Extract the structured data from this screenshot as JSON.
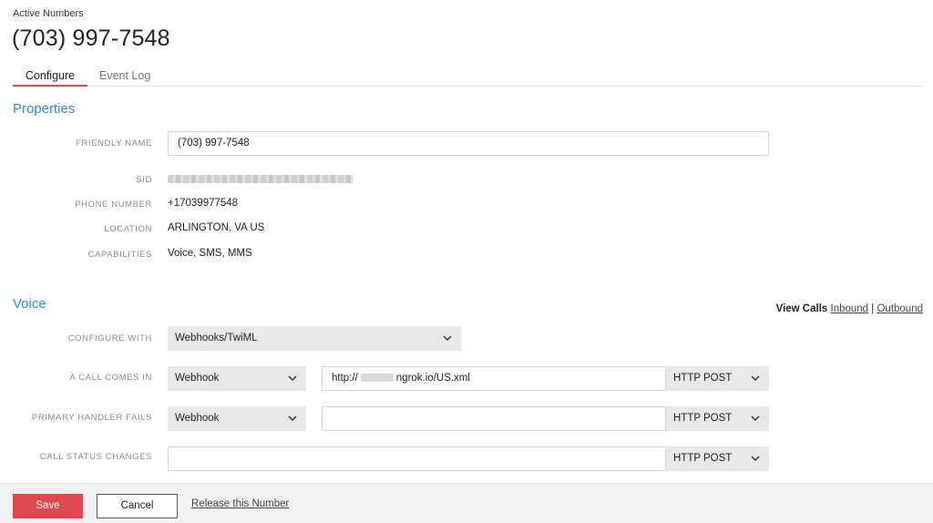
{
  "header": {
    "breadcrumb": "Active Numbers",
    "title": "(703) 997-7548"
  },
  "tabs": [
    {
      "label": "Configure",
      "active": true
    },
    {
      "label": "Event Log",
      "active": false
    }
  ],
  "properties": {
    "section_title": "Properties",
    "friendly_name_label": "FRIENDLY NAME",
    "friendly_name_value": "(703) 997-7548",
    "sid_label": "SID",
    "phone_number_label": "PHONE NUMBER",
    "phone_number_value": "+17039977548",
    "location_label": "LOCATION",
    "location_value": "ARLINGTON, VA US",
    "capabilities_label": "CAPABILITIES",
    "capabilities_value": "Voice, SMS, MMS"
  },
  "voice": {
    "section_title": "Voice",
    "view_calls_label": "View Calls",
    "inbound_link": "Inbound",
    "separator": "|",
    "outbound_link": "Outbound",
    "configure_with_label": "CONFIGURE WITH",
    "configure_with_value": "Webhooks/TwiML",
    "call_comes_in_label": "A CALL COMES IN",
    "call_comes_in_type": "Webhook",
    "call_comes_in_url_prefix": "http://",
    "call_comes_in_url_suffix": "ngrok.io/US.xml",
    "call_comes_in_method": "HTTP POST",
    "primary_handler_label": "PRIMARY HANDLER FAILS",
    "primary_handler_type": "Webhook",
    "primary_handler_url": "",
    "primary_handler_method": "HTTP POST",
    "call_status_label": "CALL STATUS CHANGES",
    "call_status_url": "",
    "call_status_method": "HTTP POST"
  },
  "footer": {
    "save_label": "Save",
    "cancel_label": "Cancel",
    "release_label": "Release this Number"
  },
  "colors": {
    "accent_red": "#e0484f",
    "section_blue": "#2e8bd6",
    "select_bg": "#e8e8e8"
  }
}
